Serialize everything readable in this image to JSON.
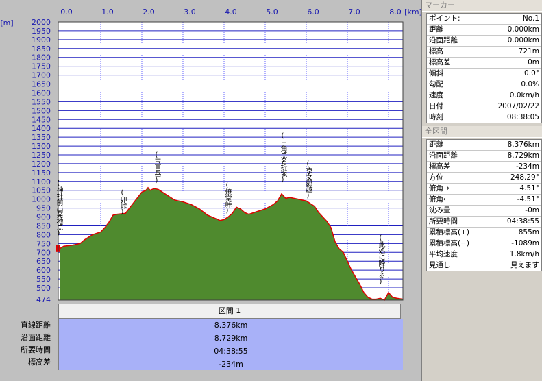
{
  "chart": {
    "x_unit": "[km]",
    "y_unit": "[m]",
    "x_ticks": [
      "0.0",
      "1.0",
      "2.0",
      "3.0",
      "4.0",
      "5.0",
      "6.0",
      "7.0",
      "8.0"
    ],
    "y_ticks": [
      "2000",
      "1950",
      "1900",
      "1850",
      "1800",
      "1750",
      "1700",
      "1650",
      "1600",
      "1550",
      "1500",
      "1450",
      "1400",
      "1350",
      "1300",
      "1250",
      "1200",
      "1150",
      "1100",
      "1050",
      "1000",
      "950",
      "900",
      "850",
      "800",
      "750",
      "700",
      "650",
      "600",
      "550",
      "500"
    ],
    "y_min_label": "474",
    "annotations": [
      {
        "text": "(神社前出発地点)"
      },
      {
        "text": "(卯峠)"
      },
      {
        "text": "(玉貴岳)"
      },
      {
        "text": "(焼堂峠)"
      },
      {
        "text": "(三角点名折坂)"
      },
      {
        "text": "(京女郎越)"
      },
      {
        "text": "(此処に降りる)"
      }
    ],
    "colors": {
      "plot_bg": "#ffffff",
      "grid_h": "#2020c0",
      "grid_v": "#6060ff",
      "fill": "#4f8a2e",
      "line": "#e00000",
      "axis_text": "#1a1ab0"
    }
  },
  "chart_data": {
    "type": "area",
    "xlabel": "[km]",
    "ylabel": "[m]",
    "xlim": [
      0,
      8.376
    ],
    "ylim": [
      474,
      2000
    ],
    "x": [
      0.0,
      0.1,
      0.3,
      0.5,
      0.6,
      0.8,
      1.0,
      1.1,
      1.2,
      1.3,
      1.4,
      1.6,
      1.7,
      1.8,
      1.9,
      2.0,
      2.1,
      2.15,
      2.2,
      2.3,
      2.4,
      2.5,
      2.6,
      2.7,
      2.8,
      3.0,
      3.2,
      3.4,
      3.6,
      3.8,
      3.9,
      4.0,
      4.1,
      4.2,
      4.3,
      4.4,
      4.5,
      4.6,
      4.8,
      5.0,
      5.2,
      5.3,
      5.4,
      5.5,
      5.6,
      5.8,
      6.0,
      6.2,
      6.3,
      6.5,
      6.6,
      6.7,
      6.8,
      6.9,
      7.0,
      7.1,
      7.2,
      7.3,
      7.4,
      7.5,
      7.6,
      7.7,
      7.8,
      7.9,
      8.0,
      8.1,
      8.2,
      8.376
    ],
    "y": [
      721,
      735,
      740,
      750,
      770,
      800,
      815,
      840,
      870,
      910,
      915,
      920,
      950,
      980,
      1010,
      1040,
      1050,
      1065,
      1050,
      1060,
      1055,
      1040,
      1025,
      1010,
      995,
      985,
      970,
      945,
      910,
      890,
      880,
      885,
      900,
      920,
      955,
      945,
      925,
      915,
      930,
      945,
      970,
      990,
      1030,
      1005,
      1010,
      1000,
      990,
      960,
      925,
      875,
      840,
      760,
      720,
      700,
      650,
      600,
      560,
      520,
      490,
      480,
      476,
      476,
      478,
      474,
      490,
      480,
      478,
      476
    ]
  },
  "section": {
    "title": "区間 1",
    "labels": [
      "直線距離",
      "沿面距離",
      "所要時間",
      "標高差"
    ],
    "values": [
      "8.376km",
      "8.729km",
      "04:38:55",
      "-234m"
    ]
  },
  "marker_panel": {
    "title": "マーカー",
    "rows": [
      {
        "k": "ポイント:",
        "v": "No.1"
      },
      {
        "k": "距離",
        "v": "0.000km"
      },
      {
        "k": "沿面距離",
        "v": "0.000km"
      },
      {
        "k": "標高",
        "v": "721m"
      },
      {
        "k": "標高差",
        "v": "0m"
      },
      {
        "k": "傾斜",
        "v": "0.0°"
      },
      {
        "k": "勾配",
        "v": "0.0%"
      },
      {
        "k": "速度",
        "v": "0.0km/h"
      },
      {
        "k": "日付",
        "v": "2007/02/22"
      },
      {
        "k": "時刻",
        "v": "08:38:05"
      }
    ]
  },
  "section_panel": {
    "title": "全区間",
    "rows": [
      {
        "k": "距離",
        "v": "8.376km"
      },
      {
        "k": "沿面距離",
        "v": "8.729km"
      },
      {
        "k": "標高差",
        "v": "-234m"
      },
      {
        "k": "方位",
        "v": "248.29°"
      },
      {
        "k": "俯角→",
        "v": "4.51°"
      },
      {
        "k": "俯角←",
        "v": "-4.51°"
      },
      {
        "k": "沈み量",
        "v": "-0m"
      },
      {
        "k": "所要時間",
        "v": "04:38:55"
      },
      {
        "k": "累積標高(+)",
        "v": "855m"
      },
      {
        "k": "累積標高(−)",
        "v": "-1089m"
      },
      {
        "k": "平均速度",
        "v": "1.8km/h"
      },
      {
        "k": "見通し",
        "v": "見えます"
      }
    ]
  }
}
